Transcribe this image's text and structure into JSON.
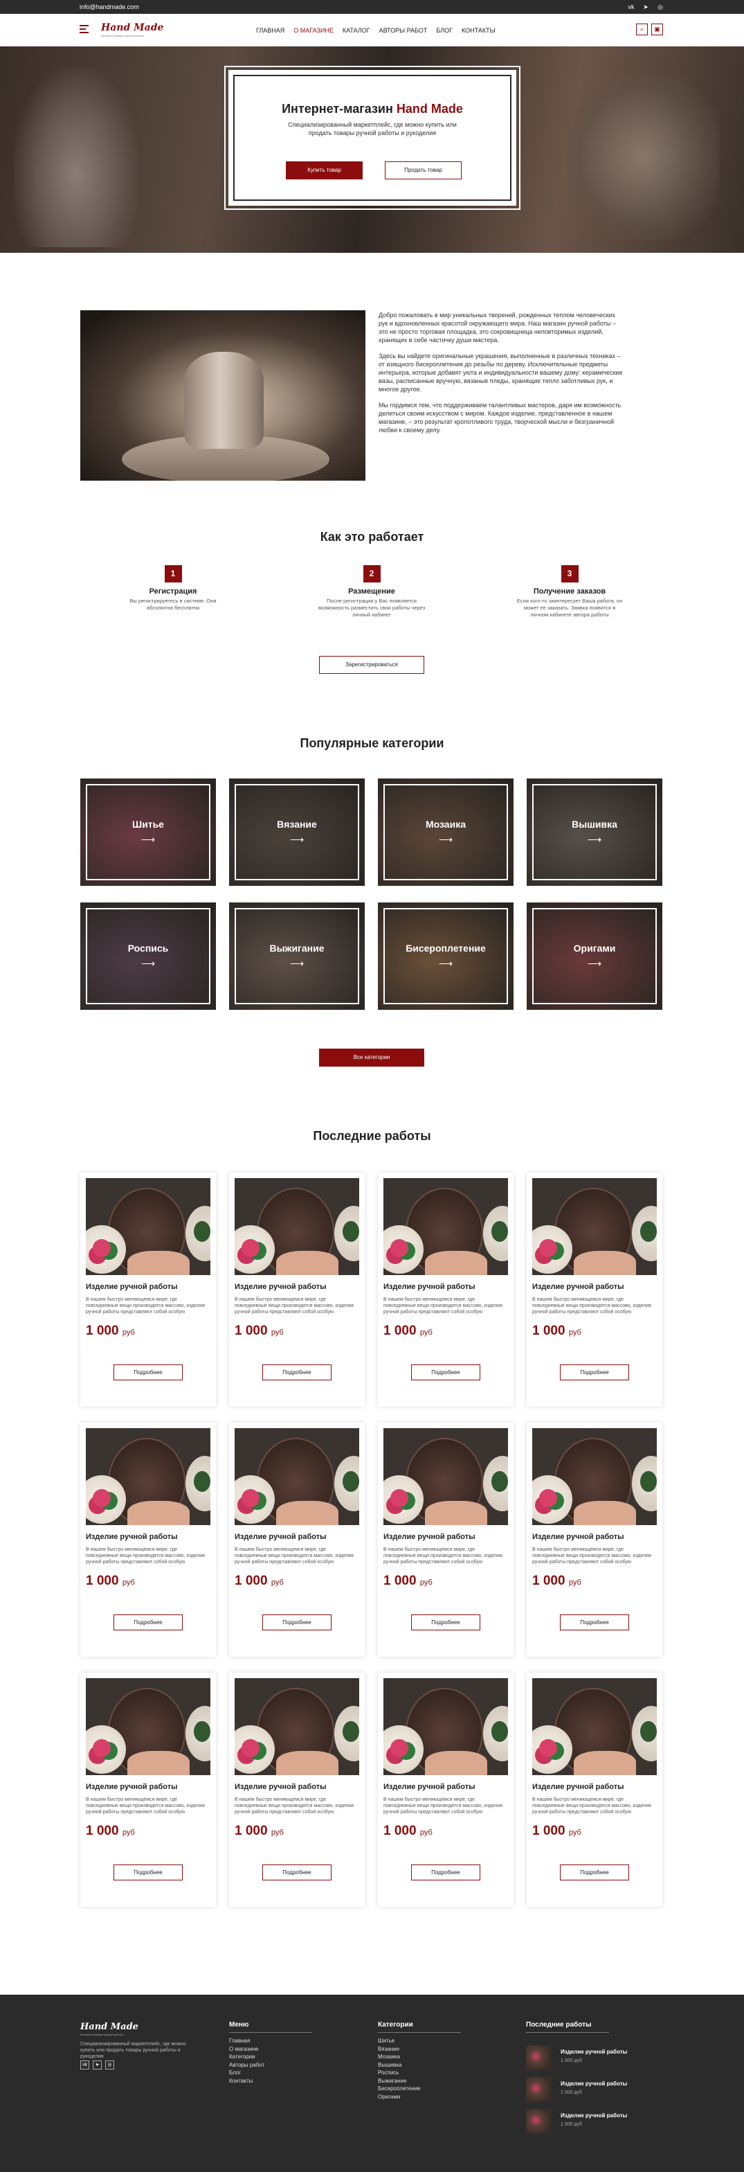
{
  "topbar": {
    "email": "info@handmade.com"
  },
  "nav": {
    "logo": "Hand Made",
    "logo_sub": "Интернет-магазин ручной работы",
    "items": [
      {
        "label": "ГЛАВНАЯ",
        "active": false
      },
      {
        "label": "О МАГАЗИНЕ",
        "active": true
      },
      {
        "label": "КАТАЛОГ",
        "active": false
      },
      {
        "label": "АВТОРЫ РАБОТ",
        "active": false
      },
      {
        "label": "БЛОГ",
        "active": false
      },
      {
        "label": "КОНТАКТЫ",
        "active": false
      }
    ]
  },
  "hero": {
    "title": "Интернет-магазин",
    "brand": "Hand Made",
    "text": "Специализированный маркетплейс, где можно купить или продать товары ручной работы и рукоделия",
    "buy_label": "Купить товар",
    "sell_label": "Продать товар"
  },
  "about": {
    "p1": "Добро пожаловать в мир уникальных творений, рожденных теплом человеческих рук и вдохновленных красотой окружающего мира. Наш магазин ручной работы – это не просто торговая площадка, это сокровищница неповторимых изделий, хранящих в себе частичку души мастера.",
    "p2": "Здесь вы найдете оригинальные украшения, выполненные в различных техниках – от изящного бисероплетения до резьбы по дереву. Исключительные предметы интерьера, которые добавят уюта и индивидуальности вашему дому: керамические вазы, расписанные вручную, вязаные пледы, хранящие тепло заботливых рук, и многое другое.",
    "p3": "Мы гордимся тем, что поддерживаем талантливых мастеров, даря им возможность делиться своим искусством с миром. Каждое изделие, представленное в нашем магазине, – это результат кропотливого труда, творческой мысли и безграничной любви к своему делу."
  },
  "how": {
    "title": "Как это работает",
    "steps": [
      {
        "num": "1",
        "title": "Регистрация",
        "text": "Вы регистрируетесь в системе. Она абсолютна бесплатна"
      },
      {
        "num": "2",
        "title": "Размещение",
        "text": "После регистрации у Вас появляется возможность разместить свои работы через личный кабинет"
      },
      {
        "num": "3",
        "title": "Получение заказов",
        "text": "Если кого-то заинтересует Ваша работа, он может ее заказать. Заявка появится в личном кабинете автора работы"
      }
    ],
    "register_label": "Зарегистрироваться"
  },
  "categories": {
    "title": "Популярные категории",
    "items": [
      {
        "label": "Шитье",
        "arrow": "⟶",
        "color": "#6b3a44"
      },
      {
        "label": "Вязание",
        "arrow": "⟶",
        "color": "#4a413a"
      },
      {
        "label": "Мозаика",
        "arrow": "⟶",
        "color": "#5a4638"
      },
      {
        "label": "Вышивка",
        "arrow": "⟶",
        "color": "#55504a"
      },
      {
        "label": "Роспись",
        "arrow": "⟶",
        "color": "#4d3b46"
      },
      {
        "label": "Выжигание",
        "arrow": "⟶",
        "color": "#5e5048"
      },
      {
        "label": "Бисероплетение",
        "arrow": "⟶",
        "color": "#6a5038"
      },
      {
        "label": "Оригами",
        "arrow": "⟶",
        "color": "#6a3a3a"
      }
    ],
    "all_label": "Все категории"
  },
  "works": {
    "title": "Последние работы",
    "items": [
      {
        "title": "Изделие ручной работы",
        "desc": "В нашем быстро меняющемся мире, где повседневные вещи производятся массово, изделия ручной работы представляют собой особую",
        "price": "1 000",
        "currency": "руб",
        "more": "Подробнее"
      },
      {
        "title": "Изделие ручной работы",
        "desc": "В нашем быстро меняющемся мире, где повседневные вещи производятся массово, изделия ручной работы представляют собой особую",
        "price": "1 000",
        "currency": "руб",
        "more": "Подробнее"
      },
      {
        "title": "Изделие ручной работы",
        "desc": "В нашем быстро меняющемся мире, где повседневные вещи производятся массово, изделия ручной работы представляют собой особую",
        "price": "1 000",
        "currency": "руб",
        "more": "Подробнее"
      },
      {
        "title": "Изделие ручной работы",
        "desc": "В нашем быстро меняющемся мире, где повседневные вещи производятся массово, изделия ручной работы представляют собой особую",
        "price": "1 000",
        "currency": "руб",
        "more": "Подробнее"
      },
      {
        "title": "Изделие ручной работы",
        "desc": "В нашем быстро меняющемся мире, где повседневные вещи производятся массово, изделия ручной работы представляют собой особую",
        "price": "1 000",
        "currency": "руб",
        "more": "Подробнее"
      },
      {
        "title": "Изделие ручной работы",
        "desc": "В нашем быстро меняющемся мире, где повседневные вещи производятся массово, изделия ручной работы представляют собой особую",
        "price": "1 000",
        "currency": "руб",
        "more": "Подробнее"
      },
      {
        "title": "Изделие ручной работы",
        "desc": "В нашем быстро меняющемся мире, где повседневные вещи производятся массово, изделия ручной работы представляют собой особую",
        "price": "1 000",
        "currency": "руб",
        "more": "Подробнее"
      },
      {
        "title": "Изделие ручной работы",
        "desc": "В нашем быстро меняющемся мире, где повседневные вещи производятся массово, изделия ручной работы представляют собой особую",
        "price": "1 000",
        "currency": "руб",
        "more": "Подробнее"
      },
      {
        "title": "Изделие ручной работы",
        "desc": "В нашем быстро меняющемся мире, где повседневные вещи производятся массово, изделия ручной работы представляют собой особую",
        "price": "1 000",
        "currency": "руб",
        "more": "Подробнее"
      },
      {
        "title": "Изделие ручной работы",
        "desc": "В нашем быстро меняющемся мире, где повседневные вещи производятся массово, изделия ручной работы представляют собой особую",
        "price": "1 000",
        "currency": "руб",
        "more": "Подробнее"
      },
      {
        "title": "Изделие ручной работы",
        "desc": "В нашем быстро меняющемся мире, где повседневные вещи производятся массово, изделия ручной работы представляют собой особую",
        "price": "1 000",
        "currency": "руб",
        "more": "Подробнее"
      },
      {
        "title": "Изделие ручной работы",
        "desc": "В нашем быстро меняющемся мире, где повседневные вещи производятся массово, изделия ручной работы представляют собой особую",
        "price": "1 000",
        "currency": "руб",
        "more": "Подробнее"
      }
    ]
  },
  "footer": {
    "logo": "Hand Made",
    "logo_sub": "Интернет-магазин ручной работы",
    "desc": "Специализированный маркетплейс, где можно купить или продать товары ручной работы и рукоделия",
    "menu_title": "Меню",
    "menu": [
      "Главная",
      "О магазине",
      "Категории",
      "Авторы работ",
      "Блог",
      "Контакты"
    ],
    "cat_title": "Категории",
    "cats": [
      "Шитье",
      "Вязание",
      "Мозаика",
      "Вышивка",
      "Роспись",
      "Выжигание",
      "Бисероплетение",
      "Оригами"
    ],
    "latest_title": "Последние работы",
    "latest": [
      {
        "title": "Изделие ручной работы",
        "price": "1 000 руб"
      },
      {
        "title": "Изделие ручной работы",
        "price": "1 000 руб"
      },
      {
        "title": "Изделие ручной работы",
        "price": "1 000 руб"
      }
    ]
  },
  "colors": {
    "accent": "#8b0d0d",
    "dark": "#2b2b2b"
  }
}
